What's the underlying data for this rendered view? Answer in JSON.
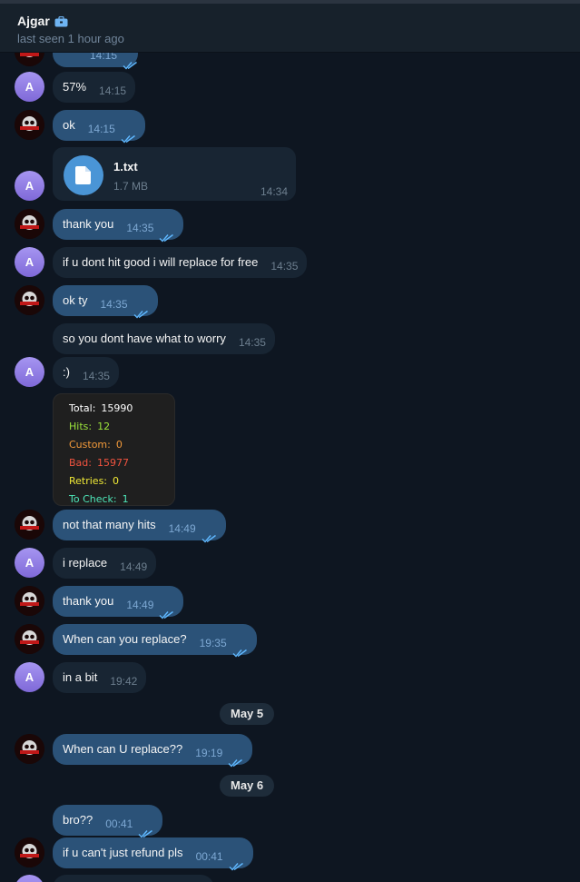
{
  "header": {
    "name": "Ajgar",
    "badge_icon": "briefcase-icon",
    "status": "last seen 1 hour ago"
  },
  "avatar_letter": "A",
  "messages": {
    "top_partial": {
      "time": "14:15"
    },
    "m1": {
      "text": "57%",
      "time": "14:15"
    },
    "m2": {
      "text": "ok",
      "time": "14:15"
    },
    "file": {
      "name": "1.txt",
      "size": "1.7 MB",
      "time": "14:34",
      "icon": "document-icon"
    },
    "m3": {
      "text": "thank you",
      "time": "14:35"
    },
    "m4": {
      "text": "if u dont hit good i will replace for free",
      "time": "14:35"
    },
    "m5": {
      "text": "ok ty",
      "time": "14:35"
    },
    "m6": {
      "text": "so you dont have what to worry",
      "time": "14:35"
    },
    "m7": {
      "text": ":)",
      "time": "14:35"
    },
    "m8": {
      "text": "not that many hits",
      "time": "14:49"
    },
    "m9": {
      "text": "i replace",
      "time": "14:49"
    },
    "m10": {
      "text": "thank you",
      "time": "14:49"
    },
    "m11": {
      "text": "When can you replace?",
      "time": "19:35"
    },
    "m12": {
      "text": "in a bit",
      "time": "19:42"
    },
    "m13": {
      "text": "When can U replace??",
      "time": "19:19"
    },
    "m14": {
      "text": "bro??",
      "time": "00:41"
    },
    "m15": {
      "text": "if u can't just refund pls",
      "time": "00:41"
    }
  },
  "stats": {
    "total_label": "Total:",
    "total_value": "15990",
    "total_color": "#ffffff",
    "hits_label": "Hits:",
    "hits_value": "12",
    "hits_color": "#9be33b",
    "custom_label": "Custom:",
    "custom_value": "0",
    "custom_color": "#f39a3a",
    "bad_label": "Bad:",
    "bad_value": "15977",
    "bad_color": "#f0533f",
    "retries_label": "Retries:",
    "retries_value": "0",
    "retries_color": "#f1ea36",
    "tocheck_label": "To Check:",
    "tocheck_value": "1",
    "tocheck_color": "#4ee6b8"
  },
  "dates": {
    "d1": "May 5",
    "d2": "May 6"
  },
  "colors": {
    "background": "#0e1621",
    "incoming_bubble": "#182533",
    "outgoing_bubble": "#2b5278",
    "read_ticks": "#5fb8ff"
  }
}
